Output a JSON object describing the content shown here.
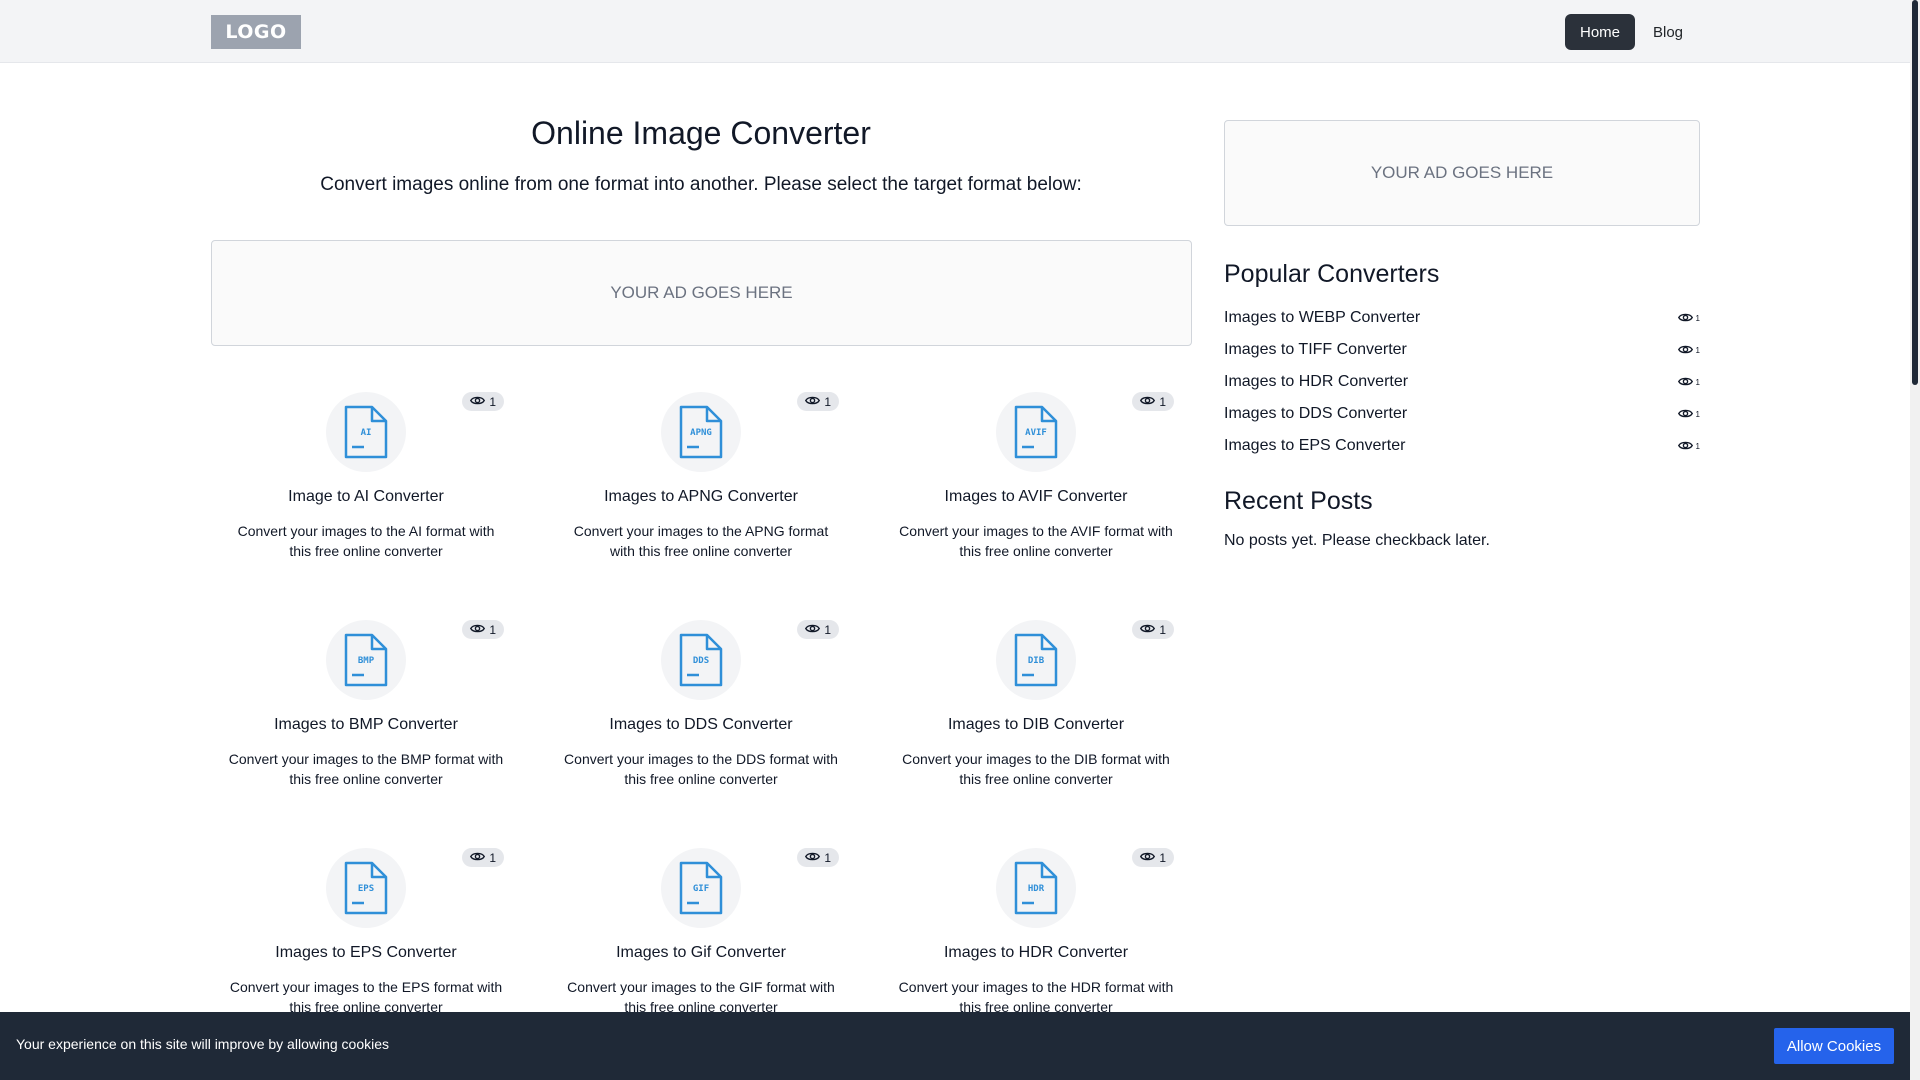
{
  "nav": {
    "logo": "LOGO",
    "home": "Home",
    "blog": "Blog"
  },
  "hero": {
    "title": "Online Image Converter",
    "subtitle": "Convert images online from one format into another. Please select the target format below:"
  },
  "ads": {
    "main": "YOUR AD GOES HERE",
    "side": "YOUR AD GOES HERE"
  },
  "converters": [
    {
      "format": "AI",
      "title": "Image to AI Converter",
      "desc": "Convert your images to the AI format with this free online converter",
      "views": "1"
    },
    {
      "format": "APNG",
      "title": "Images to APNG Converter",
      "desc": "Convert your images to the APNG format with this free online converter",
      "views": "1"
    },
    {
      "format": "AVIF",
      "title": "Images to AVIF Converter",
      "desc": "Convert your images to the AVIF format with this free online converter",
      "views": "1"
    },
    {
      "format": "BMP",
      "title": "Images to BMP Converter",
      "desc": "Convert your images to the BMP format with this free online converter",
      "views": "1"
    },
    {
      "format": "DDS",
      "title": "Images to DDS Converter",
      "desc": "Convert your images to the DDS format with this free online converter",
      "views": "1"
    },
    {
      "format": "DIB",
      "title": "Images to DIB Converter",
      "desc": "Convert your images to the DIB format with this free online converter",
      "views": "1"
    },
    {
      "format": "EPS",
      "title": "Images to EPS Converter",
      "desc": "Convert your images to the EPS format with this free online converter",
      "views": "1"
    },
    {
      "format": "GIF",
      "title": "Images to Gif Converter",
      "desc": "Convert your images to the GIF format with this free online converter",
      "views": "1"
    },
    {
      "format": "HDR",
      "title": "Images to HDR Converter",
      "desc": "Convert your images to the HDR format with this free online converter",
      "views": "1"
    }
  ],
  "sidebar": {
    "popular_heading": "Popular Converters",
    "popular": [
      {
        "label": "Images to WEBP Converter",
        "views": "1"
      },
      {
        "label": "Images to TIFF Converter",
        "views": "1"
      },
      {
        "label": "Images to HDR Converter",
        "views": "1"
      },
      {
        "label": "Images to DDS Converter",
        "views": "1"
      },
      {
        "label": "Images to EPS Converter",
        "views": "1"
      }
    ],
    "recent_heading": "Recent Posts",
    "recent_text": "No posts yet. Please checkback later."
  },
  "cookie": {
    "text": "Your experience on this site will improve by allowing cookies",
    "button": "Allow Cookies"
  },
  "colors": {
    "icon_blue": "#2f8fd8",
    "nav_dark": "#2b313a",
    "cookie_bg": "#1f2937",
    "cookie_btn": "#2563eb"
  }
}
